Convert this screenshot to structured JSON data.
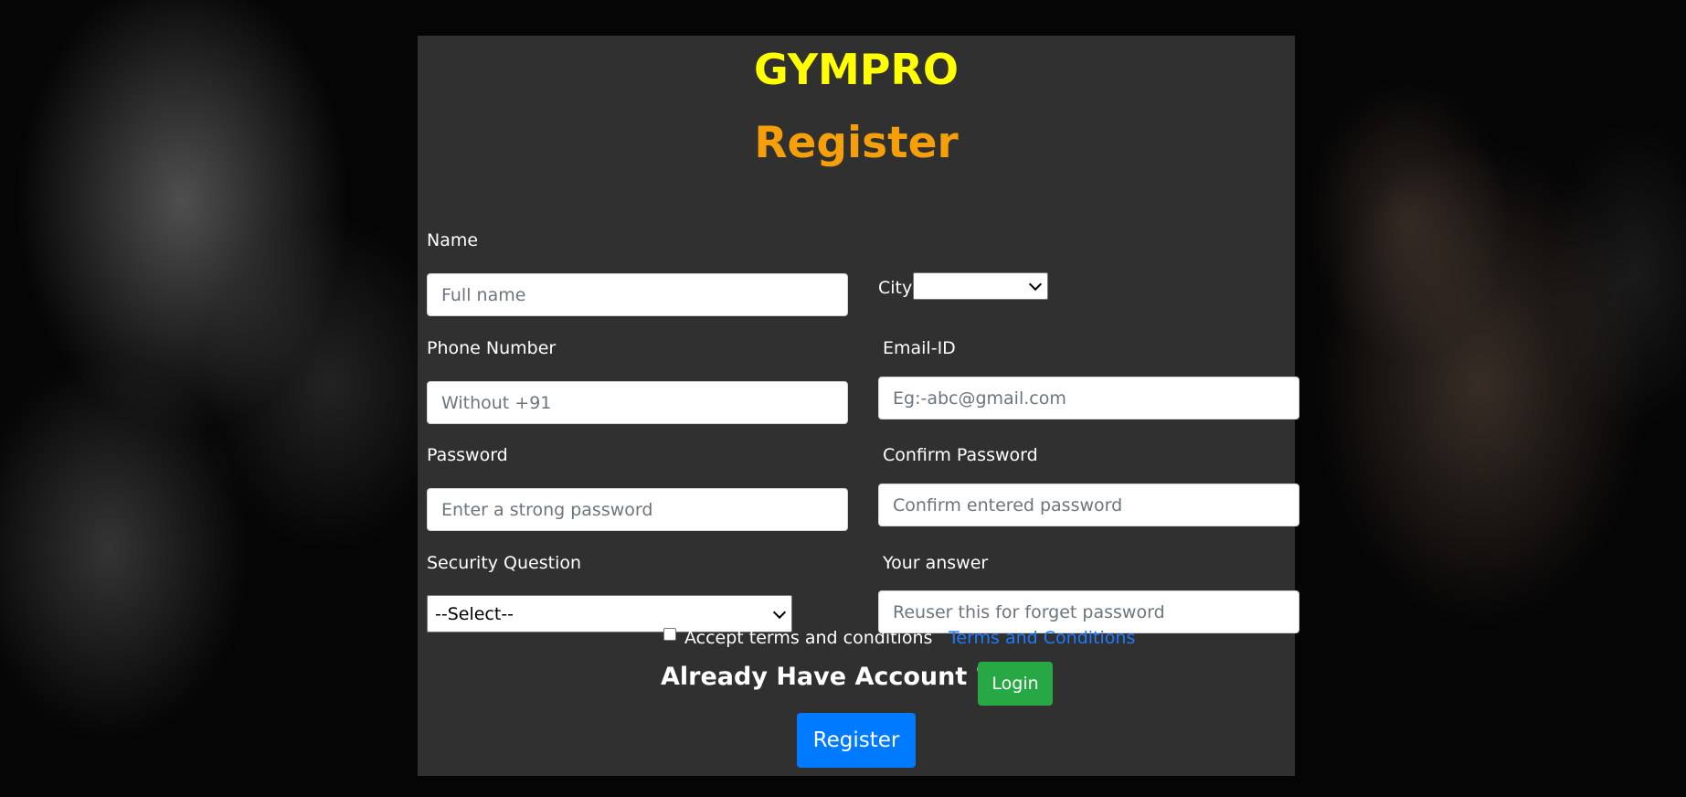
{
  "brand": "GYMPRO",
  "heading": "Register",
  "form": {
    "name": {
      "label": "Name",
      "placeholder": "Full name"
    },
    "city": {
      "label": "City",
      "selected": ""
    },
    "phone": {
      "label": "Phone Number",
      "placeholder": "Without +91"
    },
    "email": {
      "label": "Email-ID",
      "placeholder": "Eg:-abc@gmail.com"
    },
    "password": {
      "label": "Password",
      "placeholder": "Enter a strong password"
    },
    "confirm_password": {
      "label": "Confirm Password",
      "placeholder": "Confirm entered password"
    },
    "security_question": {
      "label": "Security Question",
      "selected": "--Select--"
    },
    "answer": {
      "label": "Your answer",
      "placeholder": "Reuser this for forget password"
    }
  },
  "terms": {
    "checkbox_label": "Accept terms and conditions",
    "link_label": "Terms and Conditions",
    "checked": false
  },
  "account_prompt": "Already Have Account ?",
  "login_button": "Login",
  "register_button": "Register",
  "colors": {
    "brand": "#ffff00",
    "heading": "#f59f0b",
    "login": "#28a745",
    "register": "#007bff",
    "link": "#1f7aff"
  }
}
